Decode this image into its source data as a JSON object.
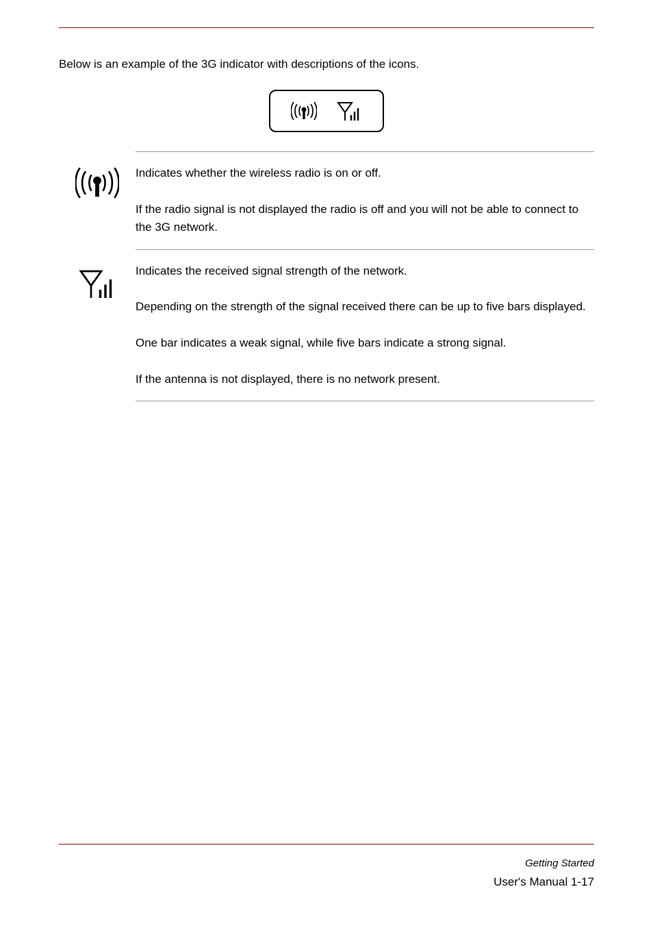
{
  "intro": "Below is an example of the 3G indicator with descriptions of the icons.",
  "rows": [
    {
      "icon": "wireless-broadcast-icon",
      "lines": [
        "Indicates whether the wireless radio is on or off.",
        "If the radio signal is not displayed the radio is off and you will not be able to connect to the 3G network."
      ]
    },
    {
      "icon": "antenna-bars-icon",
      "lines": [
        "Indicates the received signal strength of the network.",
        "Depending on the strength of the signal received there can be up to five bars displayed.",
        "One bar indicates a weak signal, while five bars indicate a strong signal.",
        "If the antenna is not displayed, there is no network present."
      ]
    }
  ],
  "chapter": "Getting Started",
  "page_number": "User's Manual   1-17"
}
